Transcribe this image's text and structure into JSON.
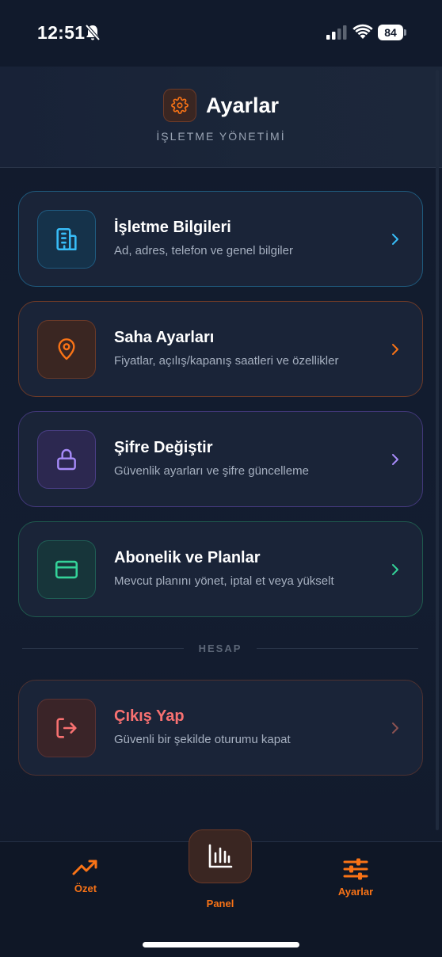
{
  "status": {
    "time": "12:51",
    "battery": "84"
  },
  "header": {
    "title": "Ayarlar",
    "subtitle": "İŞLETME YÖNETİMİ"
  },
  "cards": [
    {
      "title": "İşletme Bilgileri",
      "desc": "Ad, adres, telefon ve genel bilgiler",
      "icon": "building-icon",
      "color": "#38bdf8"
    },
    {
      "title": "Saha Ayarları",
      "desc": "Fiyatlar, açılış/kapanış saatleri ve özellikler",
      "icon": "map-pin-icon",
      "color": "#f97316"
    },
    {
      "title": "Şifre Değiştir",
      "desc": "Güvenlik ayarları ve şifre güncelleme",
      "icon": "lock-icon",
      "color": "#a78bfa"
    },
    {
      "title": "Abonelik ve Planlar",
      "desc": "Mevcut planını yönet, iptal et veya yükselt",
      "icon": "credit-card-icon",
      "color": "#34d399"
    }
  ],
  "section": {
    "account_label": "HESAP"
  },
  "logout": {
    "title": "Çıkış Yap",
    "desc": "Güvenli bir şekilde oturumu kapat",
    "icon": "logout-icon",
    "color": "#f87171"
  },
  "nav": {
    "ozet": "Özet",
    "panel": "Panel",
    "ayarlar": "Ayarlar",
    "accent": "#f97316"
  }
}
